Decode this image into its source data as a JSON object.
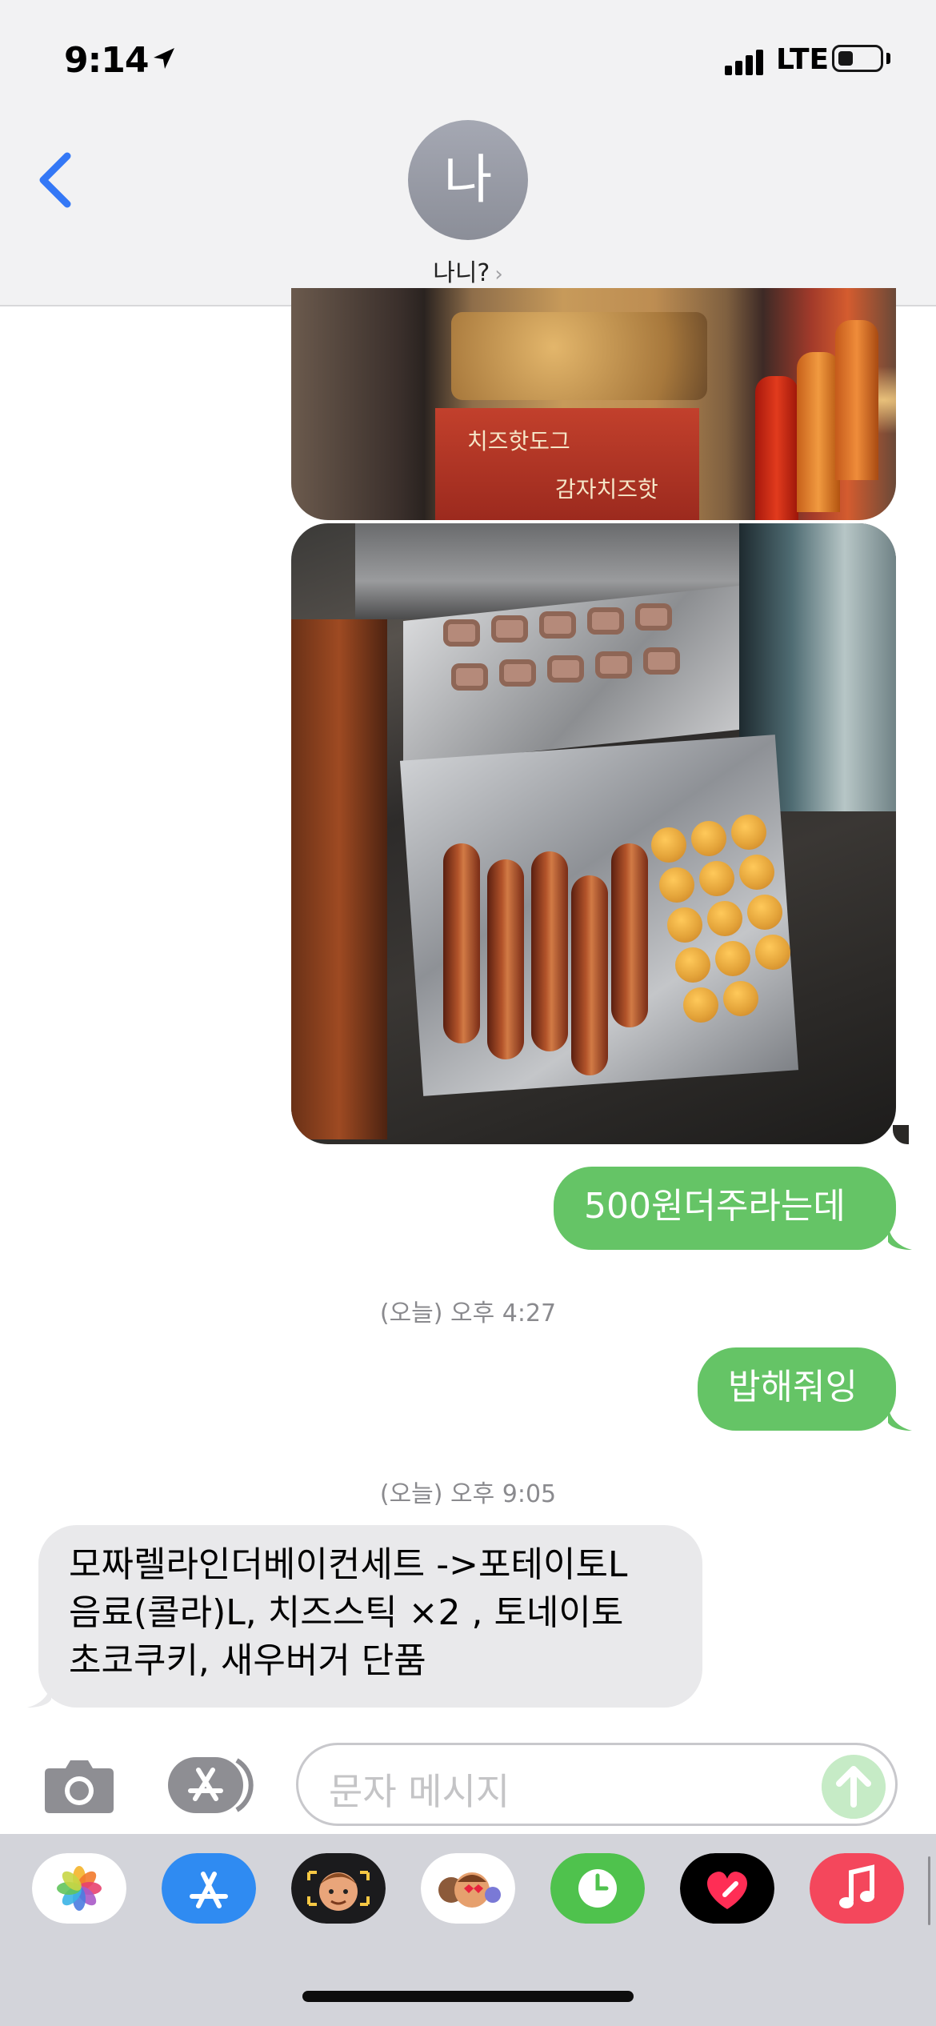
{
  "status_bar": {
    "time": "9:14",
    "network": "LTE"
  },
  "header": {
    "avatar_initial": "나",
    "contact_name": "나니?",
    "chevron": "›"
  },
  "messages": [
    {
      "type": "sent",
      "text": "500원더주라는데"
    },
    {
      "type": "timestamp",
      "text": "(오늘) 오후 4:27"
    },
    {
      "type": "sent",
      "text": "밥해줘잉"
    },
    {
      "type": "timestamp",
      "text": "(오늘) 오후 9:05"
    },
    {
      "type": "received",
      "lines": [
        "모짜렐라인더베이컨세트 ->포테이토L",
        "음료(콜라)L, 치즈스틱 ×2 , 토네이토",
        "초코쿠키, 새우버거 단품"
      ]
    }
  ],
  "photo_sign_text": {
    "line1": "치즈핫도그",
    "line2": "감자치즈핫"
  },
  "composer": {
    "placeholder": "문자 메시지"
  },
  "colors": {
    "sent_bubble": "#65c466",
    "received_bubble": "#e9e9eb",
    "accent_blue": "#3478f6",
    "header_bg": "#f2f2f3"
  },
  "app_drawer": [
    "photos-app-icon",
    "app-store-icon",
    "memoji-icon",
    "animoji-stickers-icon",
    "clock-icon",
    "digital-touch-icon",
    "music-icon"
  ]
}
